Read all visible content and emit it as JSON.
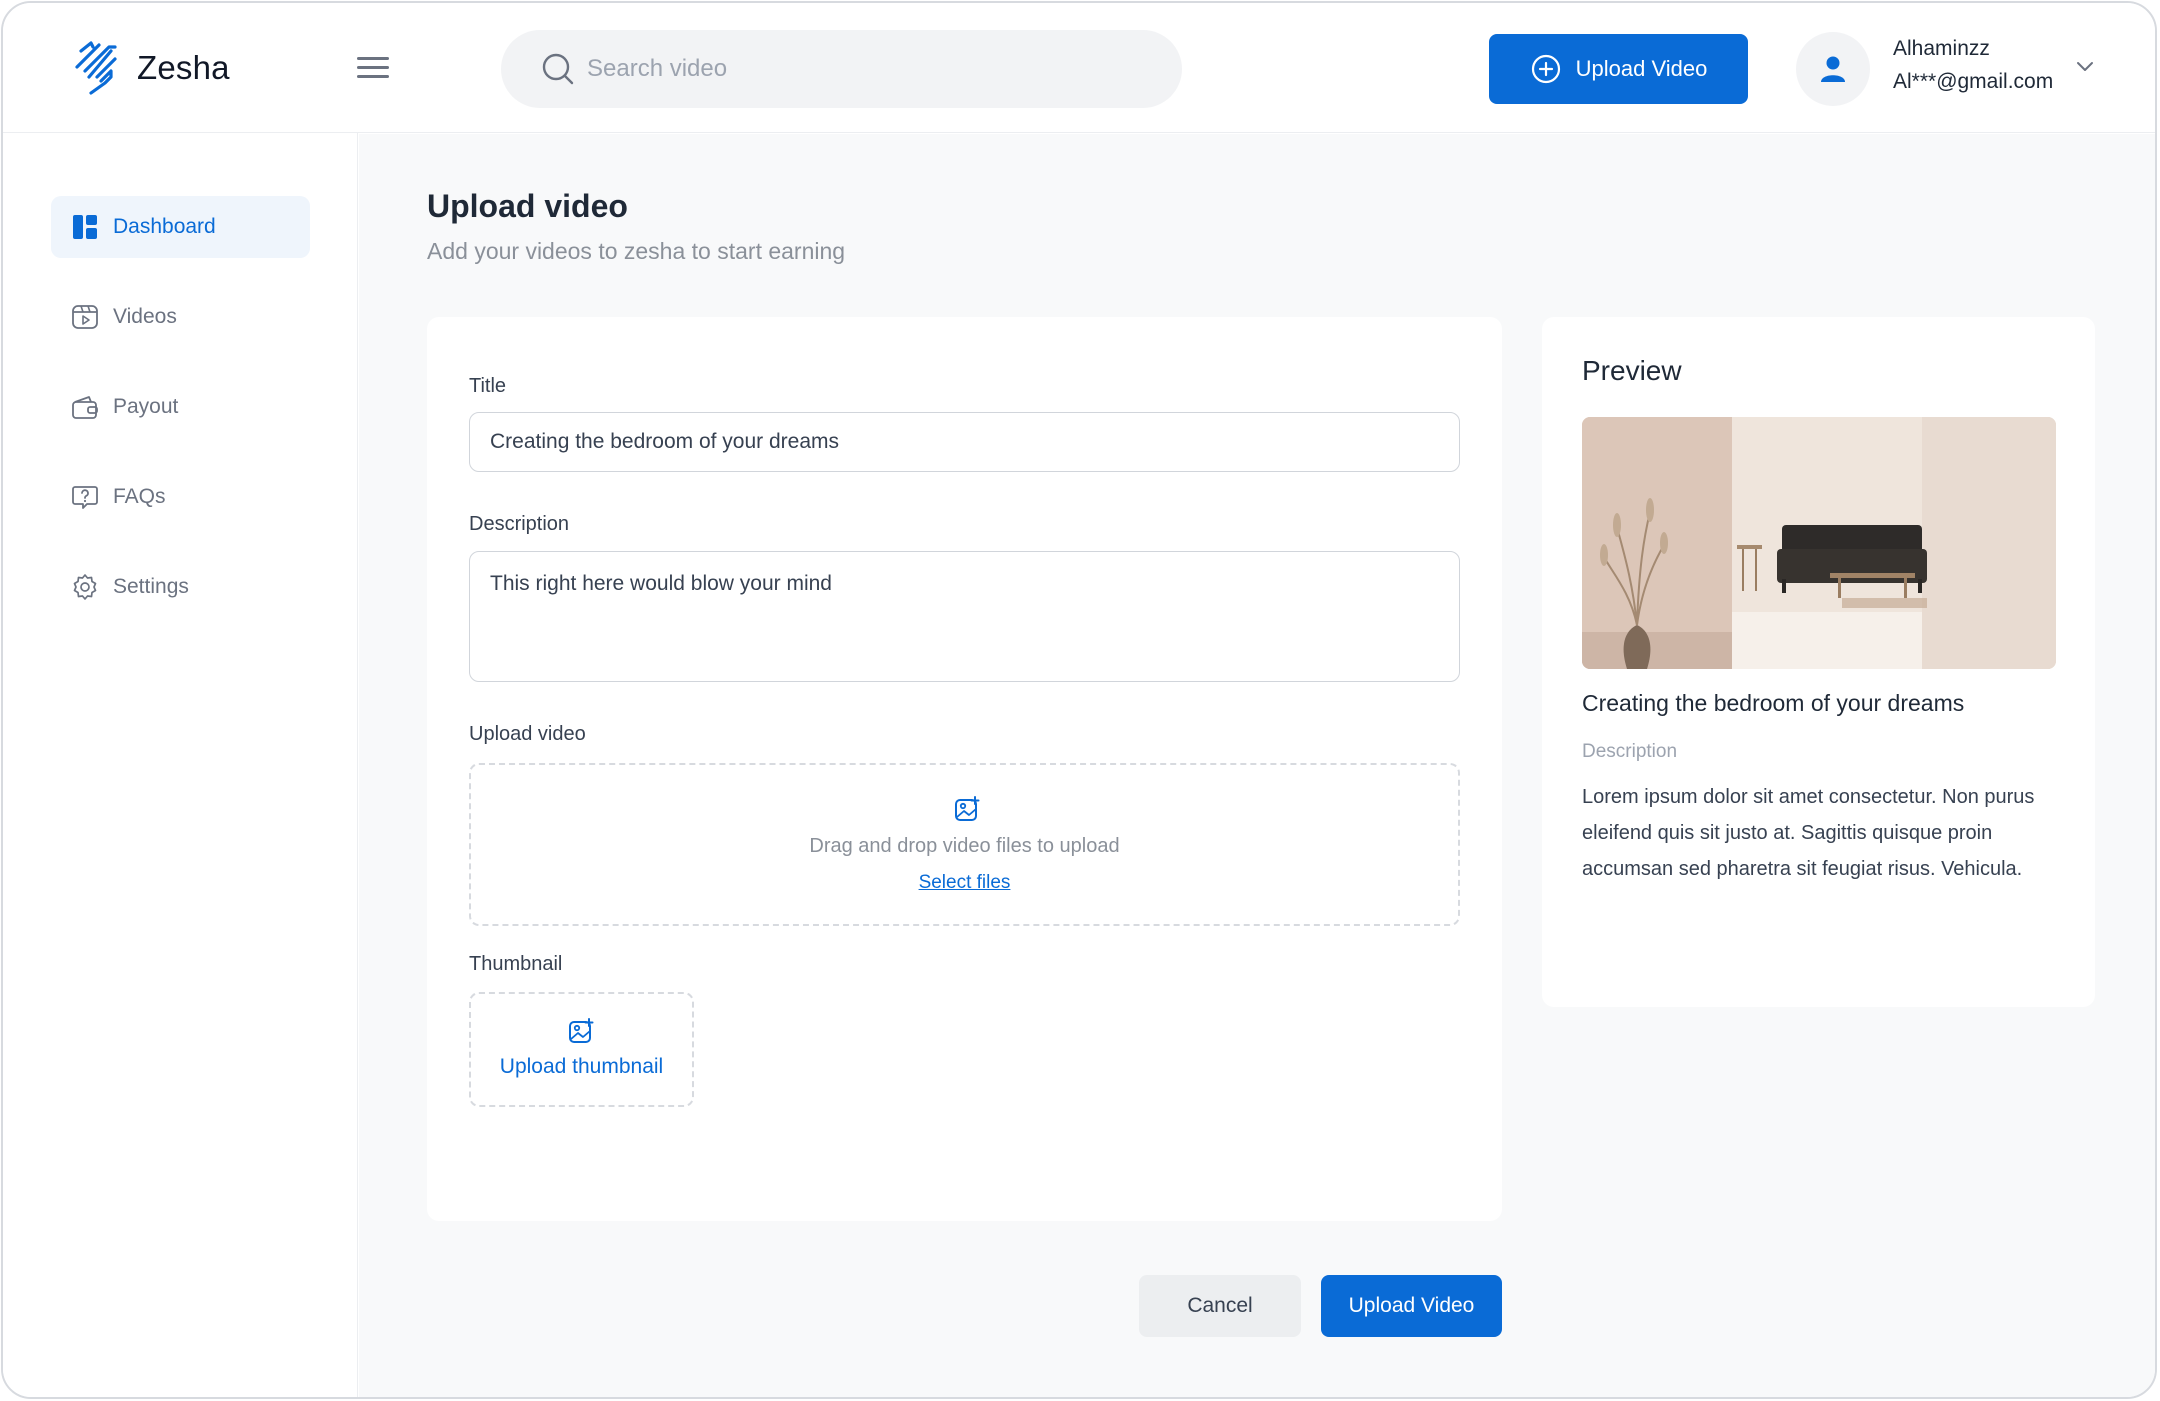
{
  "brand": {
    "name": "Zesha",
    "accent": "#0a6bd6"
  },
  "header": {
    "search_placeholder": "Search video",
    "upload_button": "Upload Video",
    "user": {
      "name": "Alhaminzz",
      "email": "Al***@gmail.com"
    }
  },
  "sidebar": {
    "items": [
      {
        "label": "Dashboard",
        "icon": "dashboard-icon",
        "active": true
      },
      {
        "label": "Videos",
        "icon": "video-icon",
        "active": false
      },
      {
        "label": "Payout",
        "icon": "wallet-icon",
        "active": false
      },
      {
        "label": "FAQs",
        "icon": "question-icon",
        "active": false
      },
      {
        "label": "Settings",
        "icon": "gear-icon",
        "active": false
      }
    ]
  },
  "page": {
    "title": "Upload video",
    "subtitle": "Add your videos to zesha to start earning"
  },
  "form": {
    "title_label": "Title",
    "title_value": "Creating the bedroom of your dreams",
    "description_label": "Description",
    "description_value": "This right here would blow your mind",
    "upload_label": "Upload video",
    "dropzone_text": "Drag and drop video files to upload",
    "dropzone_link": "Select files",
    "thumbnail_label": "Thumbnail",
    "thumbnail_action": "Upload thumbnail"
  },
  "preview": {
    "heading": "Preview",
    "video_title": "Creating the bedroom of your dreams",
    "description_label": "Description",
    "description": "Lorem ipsum dolor sit amet consectetur. Non purus eleifend quis sit justo at. Sagittis quisque proin accumsan sed pharetra sit feugiat risus. Vehicula."
  },
  "actions": {
    "cancel": "Cancel",
    "submit": "Upload Video"
  }
}
